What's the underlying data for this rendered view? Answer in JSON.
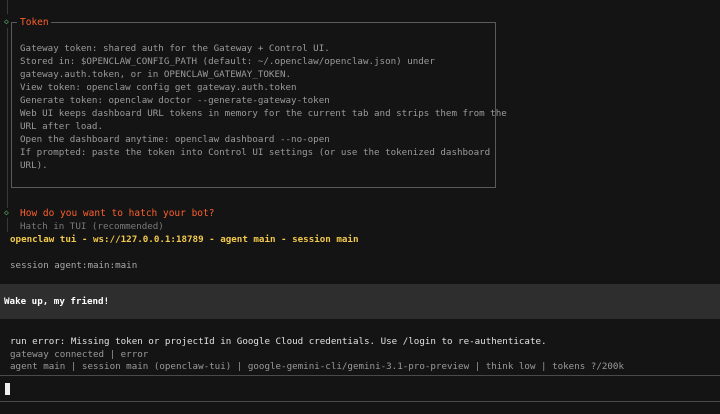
{
  "token_section": {
    "title": "Token",
    "lines": [
      "Gateway token: shared auth for the Gateway + Control UI.",
      "Stored in: $OPENCLAW_CONFIG_PATH (default: ~/.openclaw/openclaw.json) under",
      "gateway.auth.token, or in OPENCLAW_GATEWAY_TOKEN.",
      "View token: openclaw config get gateway.auth.token",
      "Generate token: openclaw doctor --generate-gateway-token",
      "Web UI keeps dashboard URL tokens in memory for the current tab and strips them from the",
      "URL after load.",
      "Open the dashboard anytime: openclaw dashboard --no-open",
      "If prompted: paste the token into Control UI settings (or use the tokenized dashboard",
      "URL)."
    ]
  },
  "hatch": {
    "question": "How do you want to hatch your bot?",
    "option": "Hatch in TUI (recommended)"
  },
  "tui": {
    "header": "openclaw tui - ws://127.0.0.1:18789 - agent main - session main",
    "session": "session agent:main:main"
  },
  "message": {
    "user_text": "Wake up, my friend!"
  },
  "output": {
    "error": "run error: Missing token or projectId in Google Cloud credentials. Use /login to re-authenticate.",
    "status": "gateway connected | error",
    "info": "agent main | session main (openclaw-tui) | google-gemini-cli/gemini-3.1-pro-preview | think low | tokens ?/200k"
  },
  "input": {
    "value": ""
  },
  "colors": {
    "accent": "#ff5f2e",
    "diamond": "#5fb86a",
    "tui_header": "#f2c94c",
    "background": "#141414"
  },
  "icons": {
    "step_marker": "diamond-icon"
  }
}
